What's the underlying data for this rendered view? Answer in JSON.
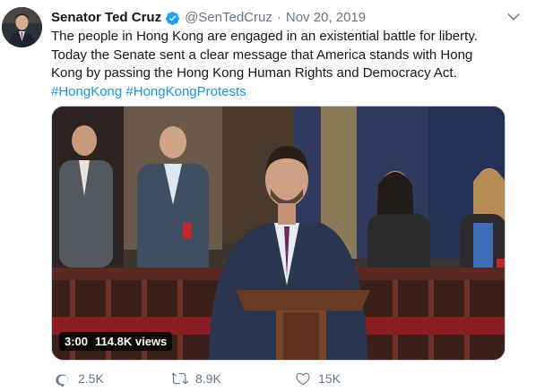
{
  "tweet": {
    "author_name": "Senator Ted Cruz",
    "handle": "@SenTedCruz",
    "separator": "·",
    "date": "Nov 20, 2019",
    "text_main": "The people in Hong Kong are engaged in an existential battle for liberty. Today the Senate sent a clear message that America stands with Hong Kong by passing the Hong Kong Human Rights and Democracy Act.",
    "hashtags": [
      "#HongKong",
      "#HongKongProtests"
    ],
    "icons": {
      "verified": "verified-badge-icon",
      "menu": "chevron-down-icon",
      "reply": "reply-icon",
      "retweet": "retweet-icon",
      "like": "heart-icon"
    },
    "colors": {
      "link": "#1b95e0",
      "verified": "#1da1f2",
      "muted": "#657786"
    }
  },
  "video": {
    "duration": "3:00",
    "views": "114.8K views"
  },
  "actions": {
    "replies": "2.5K",
    "retweets": "8.9K",
    "likes": "15K"
  }
}
